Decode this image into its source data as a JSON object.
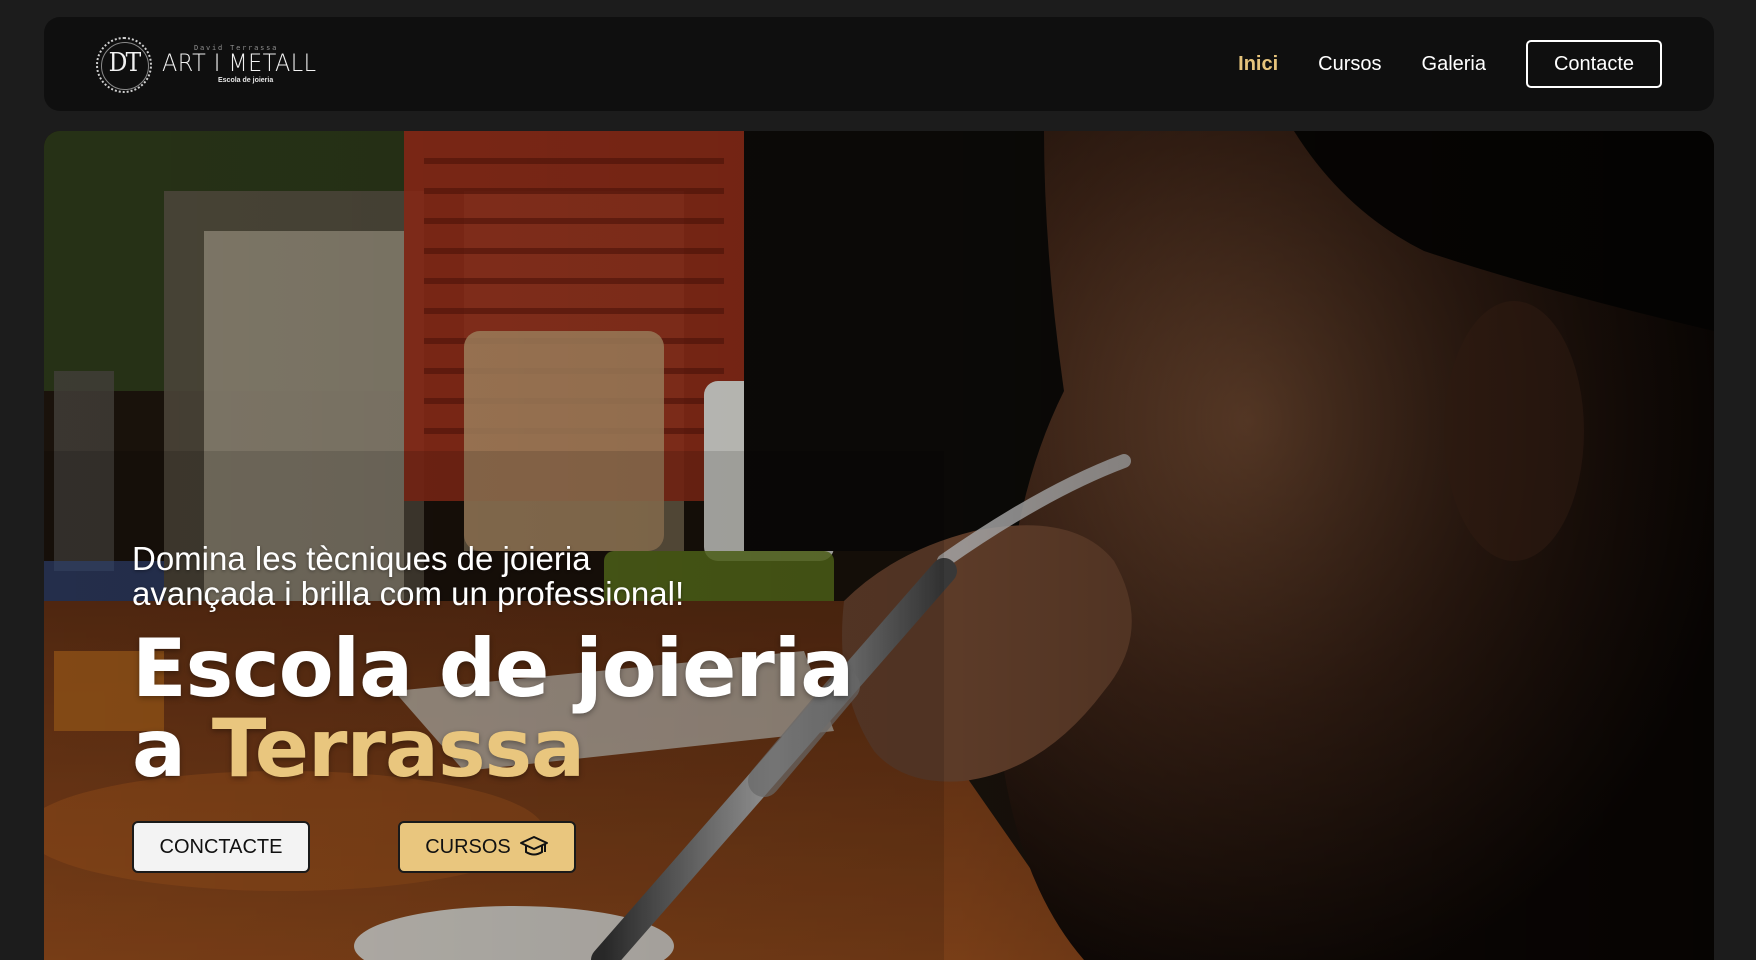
{
  "brand": {
    "initials": "DT",
    "small_name": "David Terrassa",
    "name": "ART I METALL",
    "sub": "Escola de joieria"
  },
  "nav": {
    "items": [
      {
        "label": "Inici",
        "active": true
      },
      {
        "label": "Cursos",
        "active": false
      },
      {
        "label": "Galeria",
        "active": false
      }
    ],
    "cta_label": "Contacte"
  },
  "hero": {
    "tagline_line1": "Domina les tècniques de joieria",
    "tagline_line2": "avançada i brilla com un professional!",
    "title_line1": "Escola de joieria",
    "title_line2_prefix": "a ",
    "title_line2_accent": "Terrassa",
    "buttons": {
      "contact_label": "CONCTACTE",
      "courses_label": "CURSOS",
      "courses_icon": "graduation-cap-icon"
    }
  },
  "colors": {
    "accent_gold": "#e9c67e",
    "navbar_bg": "#0f0f0f",
    "page_bg": "#1c1c1c"
  }
}
